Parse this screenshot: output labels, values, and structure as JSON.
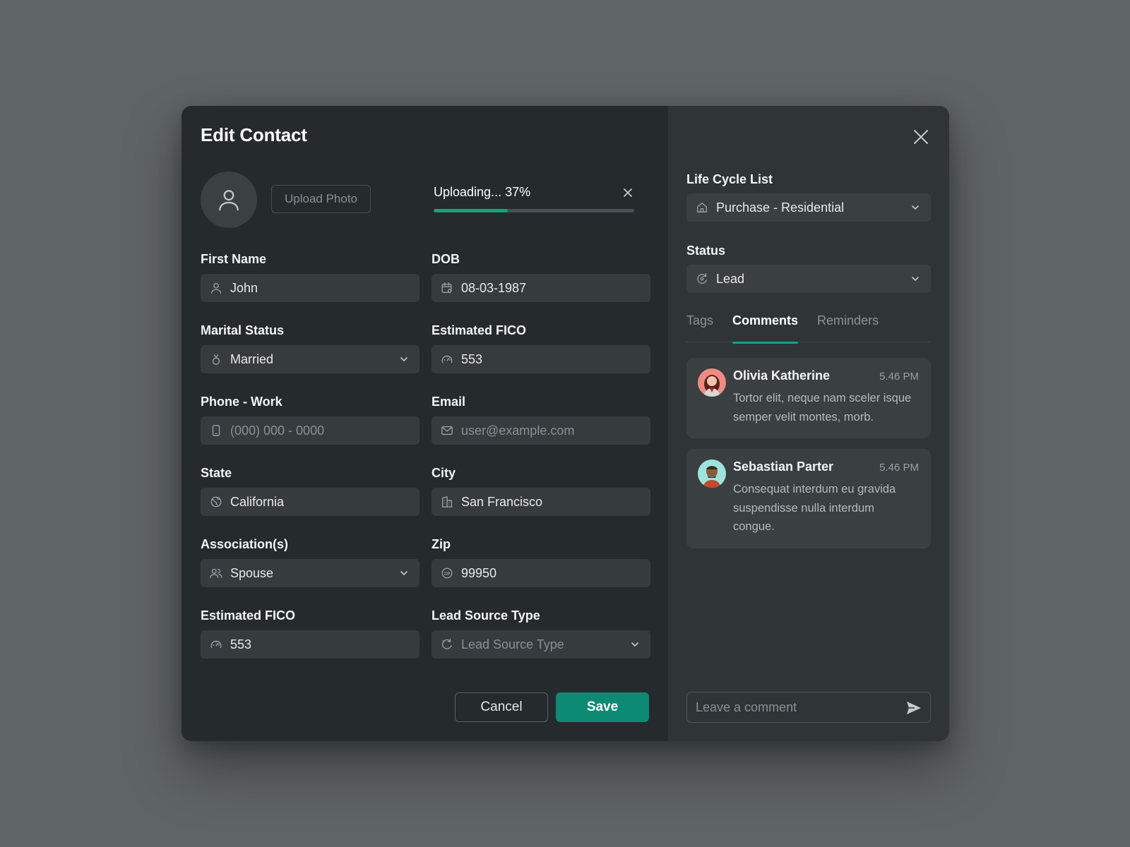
{
  "modal": {
    "title": "Edit Contact",
    "upload": {
      "button_label": "Upload Photo",
      "status_text": "Uploading... 37%",
      "progress": 0.37
    },
    "fields": [
      {
        "label": "First Name",
        "value": "John",
        "placeholder": "",
        "icon": "user-icon",
        "dropdown": false
      },
      {
        "label": "DOB",
        "value": "08-03-1987",
        "placeholder": "",
        "icon": "calendar-icon",
        "dropdown": false
      },
      {
        "label": "Marital Status",
        "value": "Married",
        "placeholder": "",
        "icon": "rings-icon",
        "dropdown": true
      },
      {
        "label": "Estimated FICO",
        "value": "553",
        "placeholder": "",
        "icon": "gauge-icon",
        "dropdown": false
      },
      {
        "label": "Phone - Work",
        "value": "",
        "placeholder": "(000) 000 - 0000",
        "icon": "phone-icon",
        "dropdown": false
      },
      {
        "label": "Email",
        "value": "",
        "placeholder": "user@example.com",
        "icon": "mail-icon",
        "dropdown": false
      },
      {
        "label": "State",
        "value": "California",
        "placeholder": "",
        "icon": "globe-icon",
        "dropdown": false
      },
      {
        "label": "City",
        "value": "San Francisco",
        "placeholder": "",
        "icon": "buildings-icon",
        "dropdown": false
      },
      {
        "label": "Association(s)",
        "value": "Spouse",
        "placeholder": "",
        "icon": "users-icon",
        "dropdown": true
      },
      {
        "label": "Zip",
        "value": "99950",
        "placeholder": "",
        "icon": "zip-icon",
        "dropdown": false
      },
      {
        "label": "Estimated FICO",
        "value": "553",
        "placeholder": "",
        "icon": "gauge-icon",
        "dropdown": false
      },
      {
        "label": "Lead Source Type",
        "value": "",
        "placeholder": "Lead Source Type",
        "icon": "source-icon",
        "dropdown": true
      }
    ],
    "footer": {
      "cancel_label": "Cancel",
      "save_label": "Save"
    }
  },
  "sidebar": {
    "lifecycle": {
      "label": "Life Cycle List",
      "value": "Purchase - Residential"
    },
    "status": {
      "label": "Status",
      "value": "Lead"
    },
    "tabs": [
      {
        "label": "Tags",
        "active": false
      },
      {
        "label": "Comments",
        "active": true
      },
      {
        "label": "Reminders",
        "active": false
      }
    ],
    "comments": [
      {
        "name": "Olivia Katherine",
        "time": "5.46 PM",
        "text": "Tortor elit, neque nam sceler isque semper velit montes, morb."
      },
      {
        "name": "Sebastian Parter",
        "time": "5.46 PM",
        "text": "Consequat interdum eu gravida suspendisse nulla interdum congue."
      }
    ],
    "comment_input": {
      "placeholder": "Leave a comment",
      "value": ""
    }
  },
  "colors": {
    "accent": "#0c8a73",
    "progress": "#10a66f",
    "panel_left": "#252a2c",
    "panel_right": "#2f3436",
    "backdrop": "#5f6467"
  }
}
